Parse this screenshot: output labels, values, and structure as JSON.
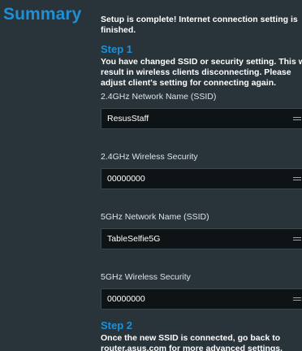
{
  "summary": {
    "title": "Summary",
    "intro": "Setup is complete! Internet connection setting is finished."
  },
  "step1": {
    "title": "Step 1",
    "lines": [
      "You have changed SSID or security setting. This wi",
      "result in wireless clients disconnecting. Please",
      "adjust client's setting for connecting again."
    ]
  },
  "fields": [
    {
      "label": "2.4GHz Network Name (SSID)",
      "value": "ResusStaff",
      "icon": "menu-icon"
    },
    {
      "label": "2.4GHz Wireless Security",
      "value": "00000000",
      "icon": "menu-icon"
    },
    {
      "label": "5GHz Network Name (SSID)",
      "value": "TableSelfie5G",
      "icon": "menu-icon"
    },
    {
      "label": "5GHz Wireless Security",
      "value": "00000000",
      "icon": "menu-icon"
    }
  ],
  "step2": {
    "title": "Step 2",
    "lines": [
      "Once the new SSID is connected, go back to",
      "router.asus.com for more advanced settings."
    ]
  },
  "colors": {
    "background": "#28333a",
    "accent": "#1e90d6",
    "field_bg": "#0e1416"
  }
}
